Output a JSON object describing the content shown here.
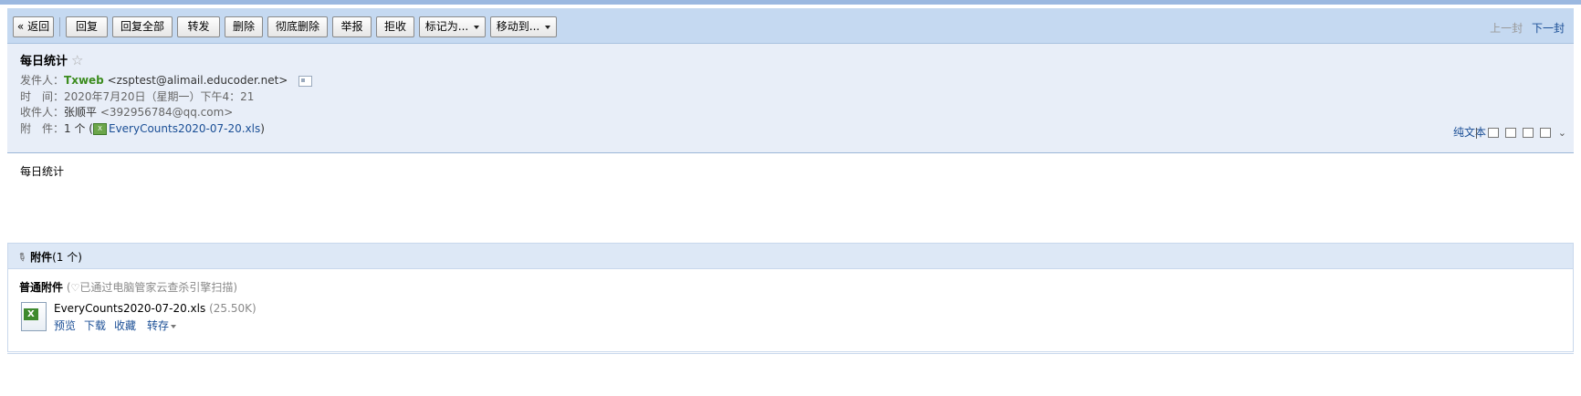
{
  "toolbar": {
    "back": "« 返回",
    "reply": "回复",
    "reply_all": "回复全部",
    "forward": "转发",
    "delete": "删除",
    "delete_permanently": "彻底删除",
    "report": "举报",
    "reject": "拒收",
    "mark_as": "标记为...",
    "move_to": "移动到...",
    "prev": "上一封",
    "next": "下一封"
  },
  "header": {
    "subject": "每日统计",
    "star": "☆",
    "from_label": "发件人：",
    "from_name": "Txweb",
    "from_email": "<zsptest@alimail.educoder.net>",
    "time_label": "时　间：",
    "time_value": "2020年7月20日（星期一）下午4：21",
    "to_label": "收件人：",
    "to_name": "张顺平",
    "to_email": "<392956784@qq.com>",
    "attach_label": "附　件：",
    "attach_count": "1 个",
    "attach_paren_open": "(",
    "attach_file": "EveryCounts2020-07-20.xls",
    "attach_paren_close": ")",
    "plain_text": "纯文本"
  },
  "body": {
    "text": "每日统计"
  },
  "attachments": {
    "title": "附件",
    "count": "(1 个)",
    "section_label": "普通附件",
    "scan_note": "已通过电脑管家云查杀引擎扫描",
    "scan_paren_open": "(",
    "scan_paren_close": ")",
    "file_name": "EveryCounts2020-07-20.xls",
    "file_size": "(25.50K)",
    "preview": "预览",
    "download": "下载",
    "favorite": "收藏",
    "save_to": "转存"
  }
}
